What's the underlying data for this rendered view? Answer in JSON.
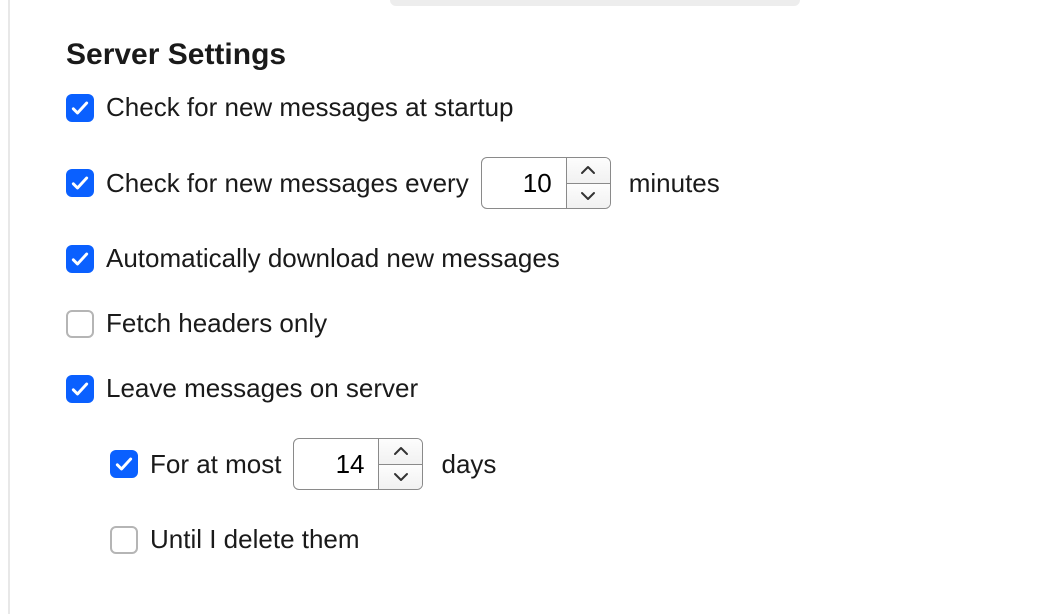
{
  "section": {
    "title": "Server Settings"
  },
  "options": {
    "check_startup": {
      "checked": true,
      "label": "Check for new messages at startup"
    },
    "check_interval": {
      "checked": true,
      "label": "Check for new messages every",
      "value": "10",
      "suffix": "minutes"
    },
    "auto_download": {
      "checked": true,
      "label": "Automatically download new messages"
    },
    "fetch_headers": {
      "checked": false,
      "label": "Fetch headers only"
    },
    "leave_on_server": {
      "checked": true,
      "label": "Leave messages on server"
    },
    "for_at_most": {
      "checked": true,
      "label": "For at most",
      "value": "14",
      "suffix": "days"
    },
    "until_delete": {
      "checked": false,
      "label": "Until I delete them"
    }
  }
}
